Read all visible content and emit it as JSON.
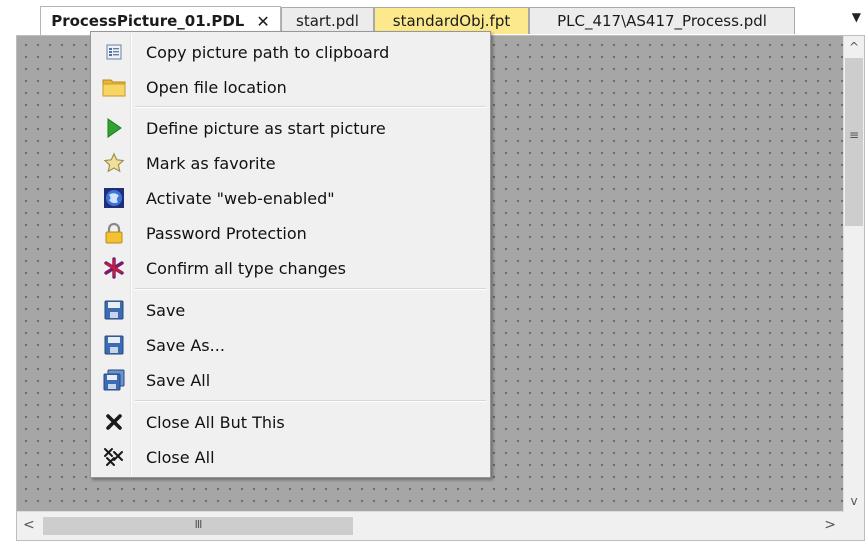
{
  "tabs": [
    {
      "label": "ProcessPicture_01.PDL",
      "close": "✕",
      "active": true
    },
    {
      "label": "start.pdl"
    },
    {
      "label": "standardObj.fpt"
    },
    {
      "label": "PLC_417\\AS417_Process.pdl"
    }
  ],
  "overflow_glyph": "▼",
  "context_menu": {
    "items": [
      {
        "label": "Copy picture path to clipboard",
        "icon": "clipboard-icon"
      },
      {
        "label": "Open file location",
        "icon": "folder-icon"
      },
      {
        "label": "Define picture as start picture",
        "icon": "play-icon"
      },
      {
        "label": "Mark as favorite",
        "icon": "star-icon"
      },
      {
        "label": "Activate \"web-enabled\"",
        "icon": "globe-icon"
      },
      {
        "label": "Password Protection",
        "icon": "lock-icon"
      },
      {
        "label": "Confirm all type changes",
        "icon": "asterisk-icon"
      },
      {
        "label": "Save",
        "icon": "floppy-icon"
      },
      {
        "label": "Save As...",
        "icon": "floppy-save-as-icon"
      },
      {
        "label": "Save All",
        "icon": "floppy-save-all-icon"
      },
      {
        "label": "Close All But This",
        "icon": "close-x-icon"
      },
      {
        "label": "Close All",
        "icon": "close-all-icon"
      }
    ]
  },
  "scrollbar_glyphs": {
    "up": "^",
    "down": "v",
    "left": "<",
    "right": ">",
    "v_grip": "≡",
    "h_grip": "III"
  },
  "colors": {
    "canvas": "#a6a6a6",
    "menu_bg": "#f0f0f0",
    "yellow_tab": "#fbe98c"
  }
}
